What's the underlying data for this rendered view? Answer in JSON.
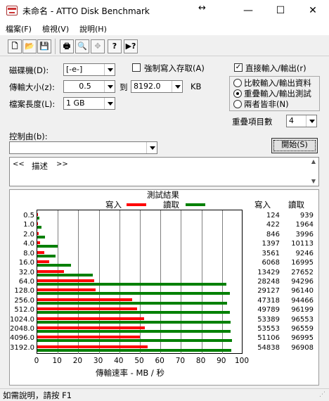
{
  "window": {
    "title": "未命名 - ATTO Disk Benchmark",
    "resize_glyph": "↔",
    "minimize": "—",
    "maximize": "☐",
    "close": "✕"
  },
  "menu": [
    {
      "label": "檔案(F)"
    },
    {
      "label": "檢視(V)"
    },
    {
      "label": "說明(H)"
    }
  ],
  "toolbar": {
    "buttons": [
      {
        "name": "new-icon",
        "glyph": "🗋"
      },
      {
        "name": "open-folder-icon",
        "glyph": "📂"
      },
      {
        "name": "save-icon",
        "glyph": "💾"
      },
      {
        "name": "print-icon",
        "glyph": "🖶"
      },
      {
        "name": "print-preview-icon",
        "glyph": "🔍"
      },
      {
        "name": "move-icon",
        "glyph": "✥"
      },
      {
        "name": "help-icon",
        "glyph": "?"
      },
      {
        "name": "context-help-icon",
        "glyph": "▶?"
      }
    ]
  },
  "form": {
    "drive_label": "磁碟機(D):",
    "drive_value": "[-e-]",
    "force_write_label": "強制寫入存取(A)",
    "force_write_checked": false,
    "transfer_size_label": "傳輸大小(z):",
    "transfer_from": "0.5",
    "transfer_to_label": "到",
    "transfer_to": "8192.0",
    "transfer_unit": "KB",
    "file_length_label": "檔案長度(L):",
    "file_length_value": "1 GB",
    "direct_io_label": "直接輸入/輸出(r)",
    "direct_io_checked": true,
    "mode_options": [
      {
        "label": "比較輸入/輸出資料",
        "selected": false
      },
      {
        "label": "重疊輸入/輸出測試",
        "selected": true
      },
      {
        "label": "兩者皆非(N)",
        "selected": false
      }
    ],
    "queue_depth_label": "重疊項目數",
    "queue_depth_value": "4",
    "controlled_by_label": "控制由(b):",
    "controlled_by_value": "",
    "start_button": "開始(S)",
    "description_left": "<<",
    "description_text": "描述",
    "description_right": ">>"
  },
  "results": {
    "title": "測試結果",
    "legend_write": "寫入",
    "legend_read": "讀取",
    "col_write": "寫入",
    "col_read": "讀取",
    "xlabel": "傳輸速率 - MB / 秒",
    "write_color": "#ff0000",
    "read_color": "#008000"
  },
  "chart_data": {
    "type": "bar",
    "orientation": "horizontal",
    "title": "測試結果",
    "xlabel": "傳輸速率 - MB / 秒",
    "xlim": [
      0,
      100
    ],
    "xticks": [
      "0",
      "10",
      "20",
      "30",
      "40",
      "50",
      "60",
      "70",
      "80",
      "90",
      "100"
    ],
    "categories": [
      "0.5",
      "1.0",
      "2.0",
      "4.0",
      "8.0",
      "16.0",
      "32.0",
      "64.0",
      "128.0",
      "256.0",
      "512.0",
      "1024.0",
      "2048.0",
      "4096.0",
      "3192.0"
    ],
    "series": [
      {
        "name": "寫入",
        "color": "#ff0000",
        "values": [
          124,
          422,
          846,
          1397,
          3561,
          6068,
          13429,
          28248,
          29127,
          47318,
          49789,
          53389,
          53553,
          51106,
          54838
        ],
        "bar_mb": [
          0.1,
          0.4,
          0.8,
          1.4,
          3.5,
          5.9,
          13.1,
          27.6,
          28.4,
          46.2,
          48.6,
          52.1,
          52.3,
          49.9,
          53.6
        ]
      },
      {
        "name": "讀取",
        "color": "#008000",
        "values": [
          939,
          1964,
          3996,
          10113,
          9246,
          16995,
          27652,
          94296,
          96140,
          94466,
          96199,
          96553,
          96559,
          96995,
          96908
        ],
        "bar_mb": [
          0.9,
          1.9,
          3.9,
          9.9,
          9.0,
          16.6,
          27.0,
          92.1,
          93.9,
          92.3,
          93.9,
          94.3,
          94.3,
          94.7,
          94.6
        ]
      }
    ],
    "grid": true,
    "legend": "top"
  },
  "status": {
    "text": "如需說明，請按 F1"
  }
}
